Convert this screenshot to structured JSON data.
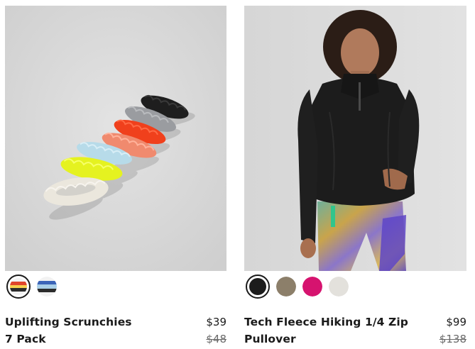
{
  "products": [
    {
      "name_line1": "Uplifting Scrunchies",
      "name_line2": "7 Pack",
      "price": "$39",
      "original_price": "$48",
      "image": "scrunchies-pack-image",
      "swatches": [
        {
          "name": "multi-warm-stripe",
          "stripes": [
            "#f2f2f2",
            "#e0452b",
            "#f6d04d",
            "#2b2b2b",
            "#f2f2f2"
          ],
          "selected": true
        },
        {
          "name": "multi-cool-stripe",
          "stripes": [
            "#f2f2f2",
            "#3b64b8",
            "#a9cfe8",
            "#2b2b2b",
            "#f2f2f2"
          ],
          "selected": false
        }
      ]
    },
    {
      "name_line1": "Tech Fleece Hiking 1/4 Zip",
      "name_line2": "Pullover",
      "price": "$99",
      "original_price": "$138",
      "image": "model-black-pullover-image",
      "swatches": [
        {
          "name": "black",
          "color": "#1c1c1c",
          "selected": true
        },
        {
          "name": "taupe",
          "color": "#8c7f6a",
          "selected": false
        },
        {
          "name": "magenta",
          "color": "#d6136f",
          "selected": false
        },
        {
          "name": "light-grey",
          "color": "#e3e1dc",
          "selected": false
        }
      ]
    }
  ]
}
